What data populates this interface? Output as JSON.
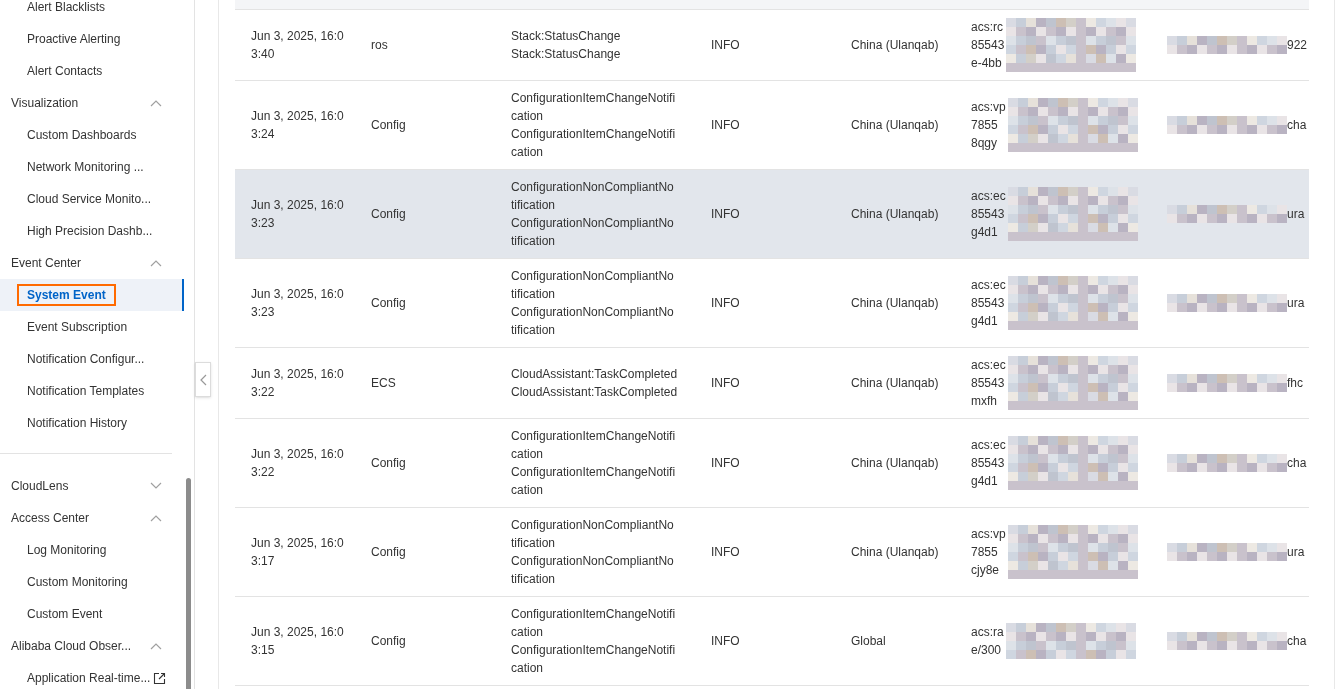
{
  "sidebar": {
    "sections": [
      [
        {
          "kind": "item",
          "label": "Alert Blacklists",
          "selected": false
        },
        {
          "kind": "item",
          "label": "Proactive Alerting",
          "selected": false
        },
        {
          "kind": "item",
          "label": "Alert Contacts",
          "selected": false
        },
        {
          "kind": "group",
          "label": "Visualization",
          "expanded": true,
          "children": [
            {
              "kind": "item",
              "label": "Custom Dashboards",
              "selected": false
            },
            {
              "kind": "item",
              "label": "Network Monitoring ...",
              "selected": false
            },
            {
              "kind": "item",
              "label": "Cloud Service Monito...",
              "selected": false
            },
            {
              "kind": "item",
              "label": "High Precision Dashb...",
              "selected": false
            }
          ]
        },
        {
          "kind": "group",
          "label": "Event Center",
          "expanded": true,
          "children": [
            {
              "kind": "item",
              "label": "System Event",
              "selected": true,
              "marked": true
            },
            {
              "kind": "item",
              "label": "Event Subscription",
              "selected": false
            },
            {
              "kind": "item",
              "label": "Notification Configur...",
              "selected": false
            },
            {
              "kind": "item",
              "label": "Notification Templates",
              "selected": false
            },
            {
              "kind": "item",
              "label": "Notification History",
              "selected": false
            }
          ]
        }
      ],
      [
        {
          "kind": "group",
          "label": "CloudLens",
          "expanded": false
        },
        {
          "kind": "group",
          "label": "Access Center",
          "expanded": true,
          "children": [
            {
              "kind": "item",
              "label": "Log Monitoring",
              "selected": false
            },
            {
              "kind": "item",
              "label": "Custom Monitoring",
              "selected": false
            },
            {
              "kind": "item",
              "label": "Custom Event",
              "selected": false
            }
          ]
        },
        {
          "kind": "group",
          "label": "Alibaba Cloud Obser...",
          "expanded": true,
          "children": [
            {
              "kind": "item",
              "label": "Application Real-time...",
              "selected": false,
              "external": true
            }
          ]
        }
      ]
    ]
  },
  "table": {
    "rows": [
      {
        "highlighted": false,
        "time": [
          "Jun 3, 2025, 16:0",
          "3:40"
        ],
        "source": "ros",
        "event": [
          "Stack:StatusChange",
          "Stack:StatusChange"
        ],
        "level": "INFO",
        "region": "China (Ulanqab)",
        "resource": [
          "acs:rc",
          "85543",
          "e-4bb"
        ],
        "column_7": "922"
      },
      {
        "highlighted": false,
        "time": [
          "Jun 3, 2025, 16:0",
          "3:24"
        ],
        "source": "Config",
        "event": [
          "ConfigurationItemChangeNotifi",
          "cation",
          "ConfigurationItemChangeNotifi",
          "cation"
        ],
        "level": "INFO",
        "region": "China (Ulanqab)",
        "resource": [
          "acs:vp",
          "7855",
          "8qgy"
        ],
        "column_7": "cha"
      },
      {
        "highlighted": true,
        "time": [
          "Jun 3, 2025, 16:0",
          "3:23"
        ],
        "source": "Config",
        "event": [
          "ConfigurationNonCompliantNo",
          "tification",
          "ConfigurationNonCompliantNo",
          "tification"
        ],
        "level": "INFO",
        "region": "China (Ulanqab)",
        "resource": [
          "acs:ec",
          "85543",
          "g4d1"
        ],
        "column_7": "ura"
      },
      {
        "highlighted": false,
        "time": [
          "Jun 3, 2025, 16:0",
          "3:23"
        ],
        "source": "Config",
        "event": [
          "ConfigurationNonCompliantNo",
          "tification",
          "ConfigurationNonCompliantNo",
          "tification"
        ],
        "level": "INFO",
        "region": "China (Ulanqab)",
        "resource": [
          "acs:ec",
          "85543",
          "g4d1"
        ],
        "column_7": "ura"
      },
      {
        "highlighted": false,
        "time": [
          "Jun 3, 2025, 16:0",
          "3:22"
        ],
        "source": "ECS",
        "event": [
          "CloudAssistant:TaskCompleted",
          "CloudAssistant:TaskCompleted"
        ],
        "level": "INFO",
        "region": "China (Ulanqab)",
        "resource": [
          "acs:ec",
          "85543",
          "mxfh"
        ],
        "column_7": "fhc"
      },
      {
        "highlighted": false,
        "time": [
          "Jun 3, 2025, 16:0",
          "3:22"
        ],
        "source": "Config",
        "event": [
          "ConfigurationItemChangeNotifi",
          "cation",
          "ConfigurationItemChangeNotifi",
          "cation"
        ],
        "level": "INFO",
        "region": "China (Ulanqab)",
        "resource": [
          "acs:ec",
          "85543",
          "g4d1"
        ],
        "column_7": "cha"
      },
      {
        "highlighted": false,
        "time": [
          "Jun 3, 2025, 16:0",
          "3:17"
        ],
        "source": "Config",
        "event": [
          "ConfigurationNonCompliantNo",
          "tification",
          "ConfigurationNonCompliantNo",
          "tification"
        ],
        "level": "INFO",
        "region": "China (Ulanqab)",
        "resource": [
          "acs:vp",
          "7855",
          "cjy8e"
        ],
        "column_7": "ura"
      },
      {
        "highlighted": false,
        "time": [
          "Jun 3, 2025, 16:0",
          "3:15"
        ],
        "source": "Config",
        "event": [
          "ConfigurationItemChangeNotifi",
          "cation",
          "ConfigurationItemChangeNotifi",
          "cation"
        ],
        "level": "INFO",
        "region": "Global",
        "resource": [
          "acs:ra",
          "e/300"
        ],
        "column_7": "cha"
      }
    ]
  }
}
